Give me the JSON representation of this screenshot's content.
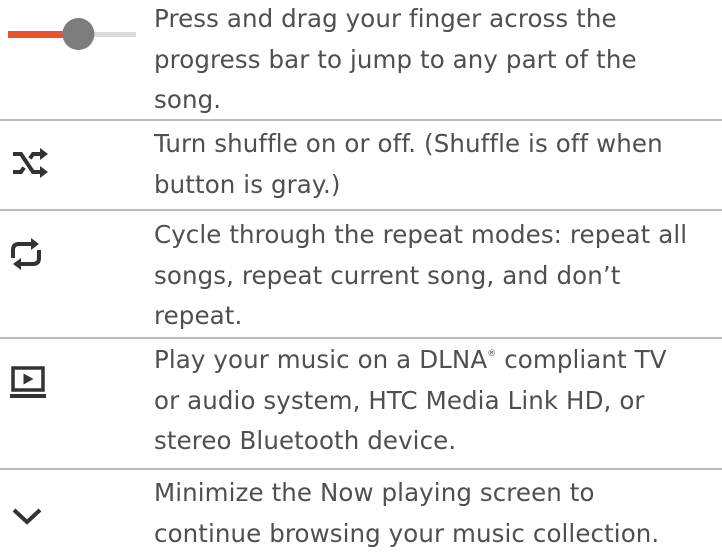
{
  "rows": [
    {
      "icon": "progress-bar-icon",
      "progress_fraction": 0.55,
      "lines": [
        "Press and drag your finger across the",
        "progress bar to jump to any part of the",
        "song."
      ]
    },
    {
      "icon": "shuffle-icon",
      "lines": [
        "Turn shuffle on or off. (Shuffle is off when",
        "button is gray.)"
      ]
    },
    {
      "icon": "repeat-icon",
      "lines": [
        "Cycle through the repeat modes: repeat all",
        "songs, repeat current song, and don’t",
        "repeat."
      ]
    },
    {
      "icon": "play-on-tv-icon",
      "lines": [
        "Play your music on a DLNA",
        " compliant TV",
        "or audio system, HTC Media Link HD, or",
        "stereo Bluetooth device."
      ],
      "superscript": "®"
    },
    {
      "icon": "chevron-down-icon",
      "lines": [
        "Minimize the Now playing screen to",
        "continue browsing your music collection."
      ]
    }
  ],
  "colors": {
    "accent": "#e8522f",
    "track": "#dcdcdc",
    "thumb": "#7d7d7d",
    "icon": "#333333",
    "divider": "#bdbdbd",
    "text": "#4f4f4f"
  }
}
